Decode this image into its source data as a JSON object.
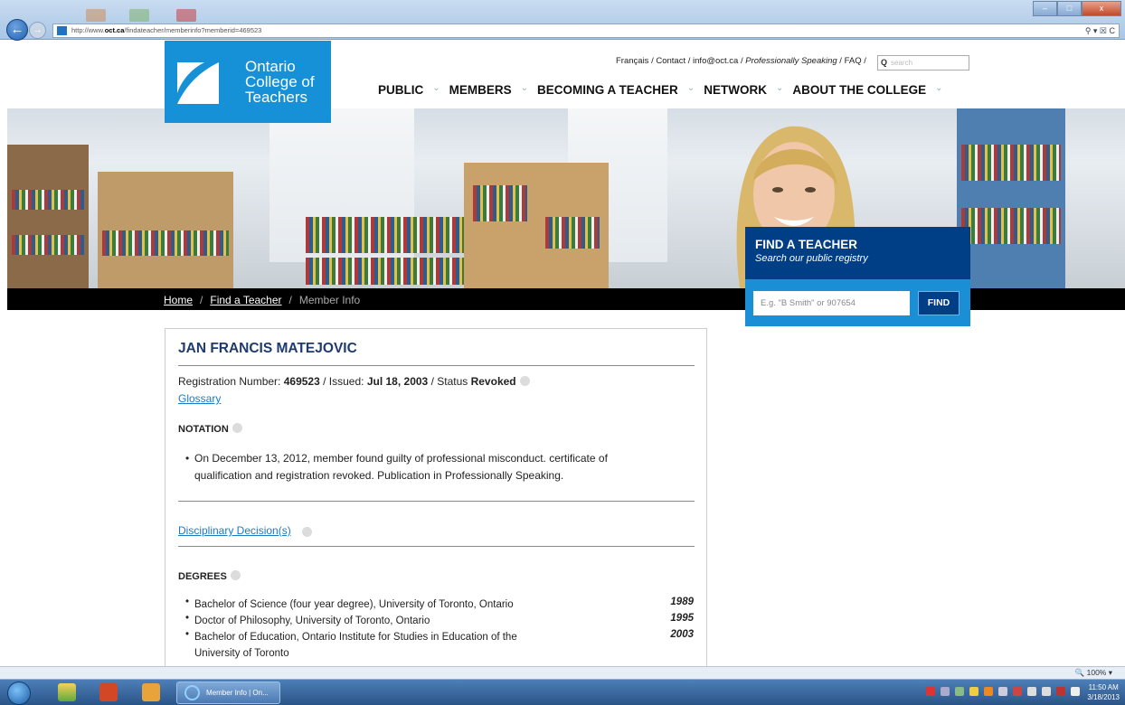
{
  "browser": {
    "url_prefix": "http://www.",
    "url_domain": "oct.ca",
    "url_path": "/findateacher/memberinfo?memberid=469523",
    "tools": "⚲ ▾ ☒ C",
    "window_buttons": [
      "–",
      "□",
      "x"
    ],
    "zoom": "🔍 100%  ▾"
  },
  "utility_nav": {
    "francais": "Français",
    "contact": "Contact",
    "email": "info@oct.ca",
    "ps": "Professionally Speaking",
    "faq": "FAQ",
    "search_placeholder": "search"
  },
  "logo": {
    "line1": "Ontario",
    "line2": "College of",
    "line3": "Teachers"
  },
  "main_nav": [
    "PUBLIC",
    "MEMBERS",
    "BECOMING A TEACHER",
    "NETWORK",
    "ABOUT THE COLLEGE"
  ],
  "breadcrumb": {
    "home": "Home",
    "find": "Find a Teacher",
    "current": "Member Info"
  },
  "find_teacher": {
    "title": "FIND A TEACHER",
    "subtitle": "Search our public registry",
    "placeholder": "E.g. \"B Smith\" or 907654",
    "button": "FIND"
  },
  "member": {
    "name": "JAN FRANCIS MATEJOVIC",
    "reg_label": "Registration Number:",
    "reg_number": "469523",
    "issued_label": "/  Issued:",
    "issued": "Jul 18, 2003",
    "status_label": "/ Status",
    "status": "Revoked",
    "glossary": "Glossary",
    "notation_header": "NOTATION",
    "notation_text": "On December 13, 2012, member found guilty of professional misconduct. certificate of qualification and registration revoked. Publication in Professionally Speaking.",
    "disciplinary_link": "Disciplinary Decision(s)",
    "degrees_header": "DEGREES",
    "degrees": [
      {
        "name": "Bachelor of Science (four year degree), University of Toronto, Ontario",
        "year": "1989"
      },
      {
        "name": "Doctor of Philosophy, University of Toronto, Ontario",
        "year": "1995"
      },
      {
        "name": "Bachelor of Education, Ontario Institute for Studies in Education of the University of Toronto",
        "year": "2003"
      }
    ]
  },
  "taskbar": {
    "task_label": "Member Info | On...",
    "time": "11:50 AM",
    "date": "3/18/2013"
  },
  "colors": {
    "brand_blue": "#1691d8",
    "navy": "#003e86",
    "link": "#1a7bc2",
    "name": "#1e3a6e"
  }
}
